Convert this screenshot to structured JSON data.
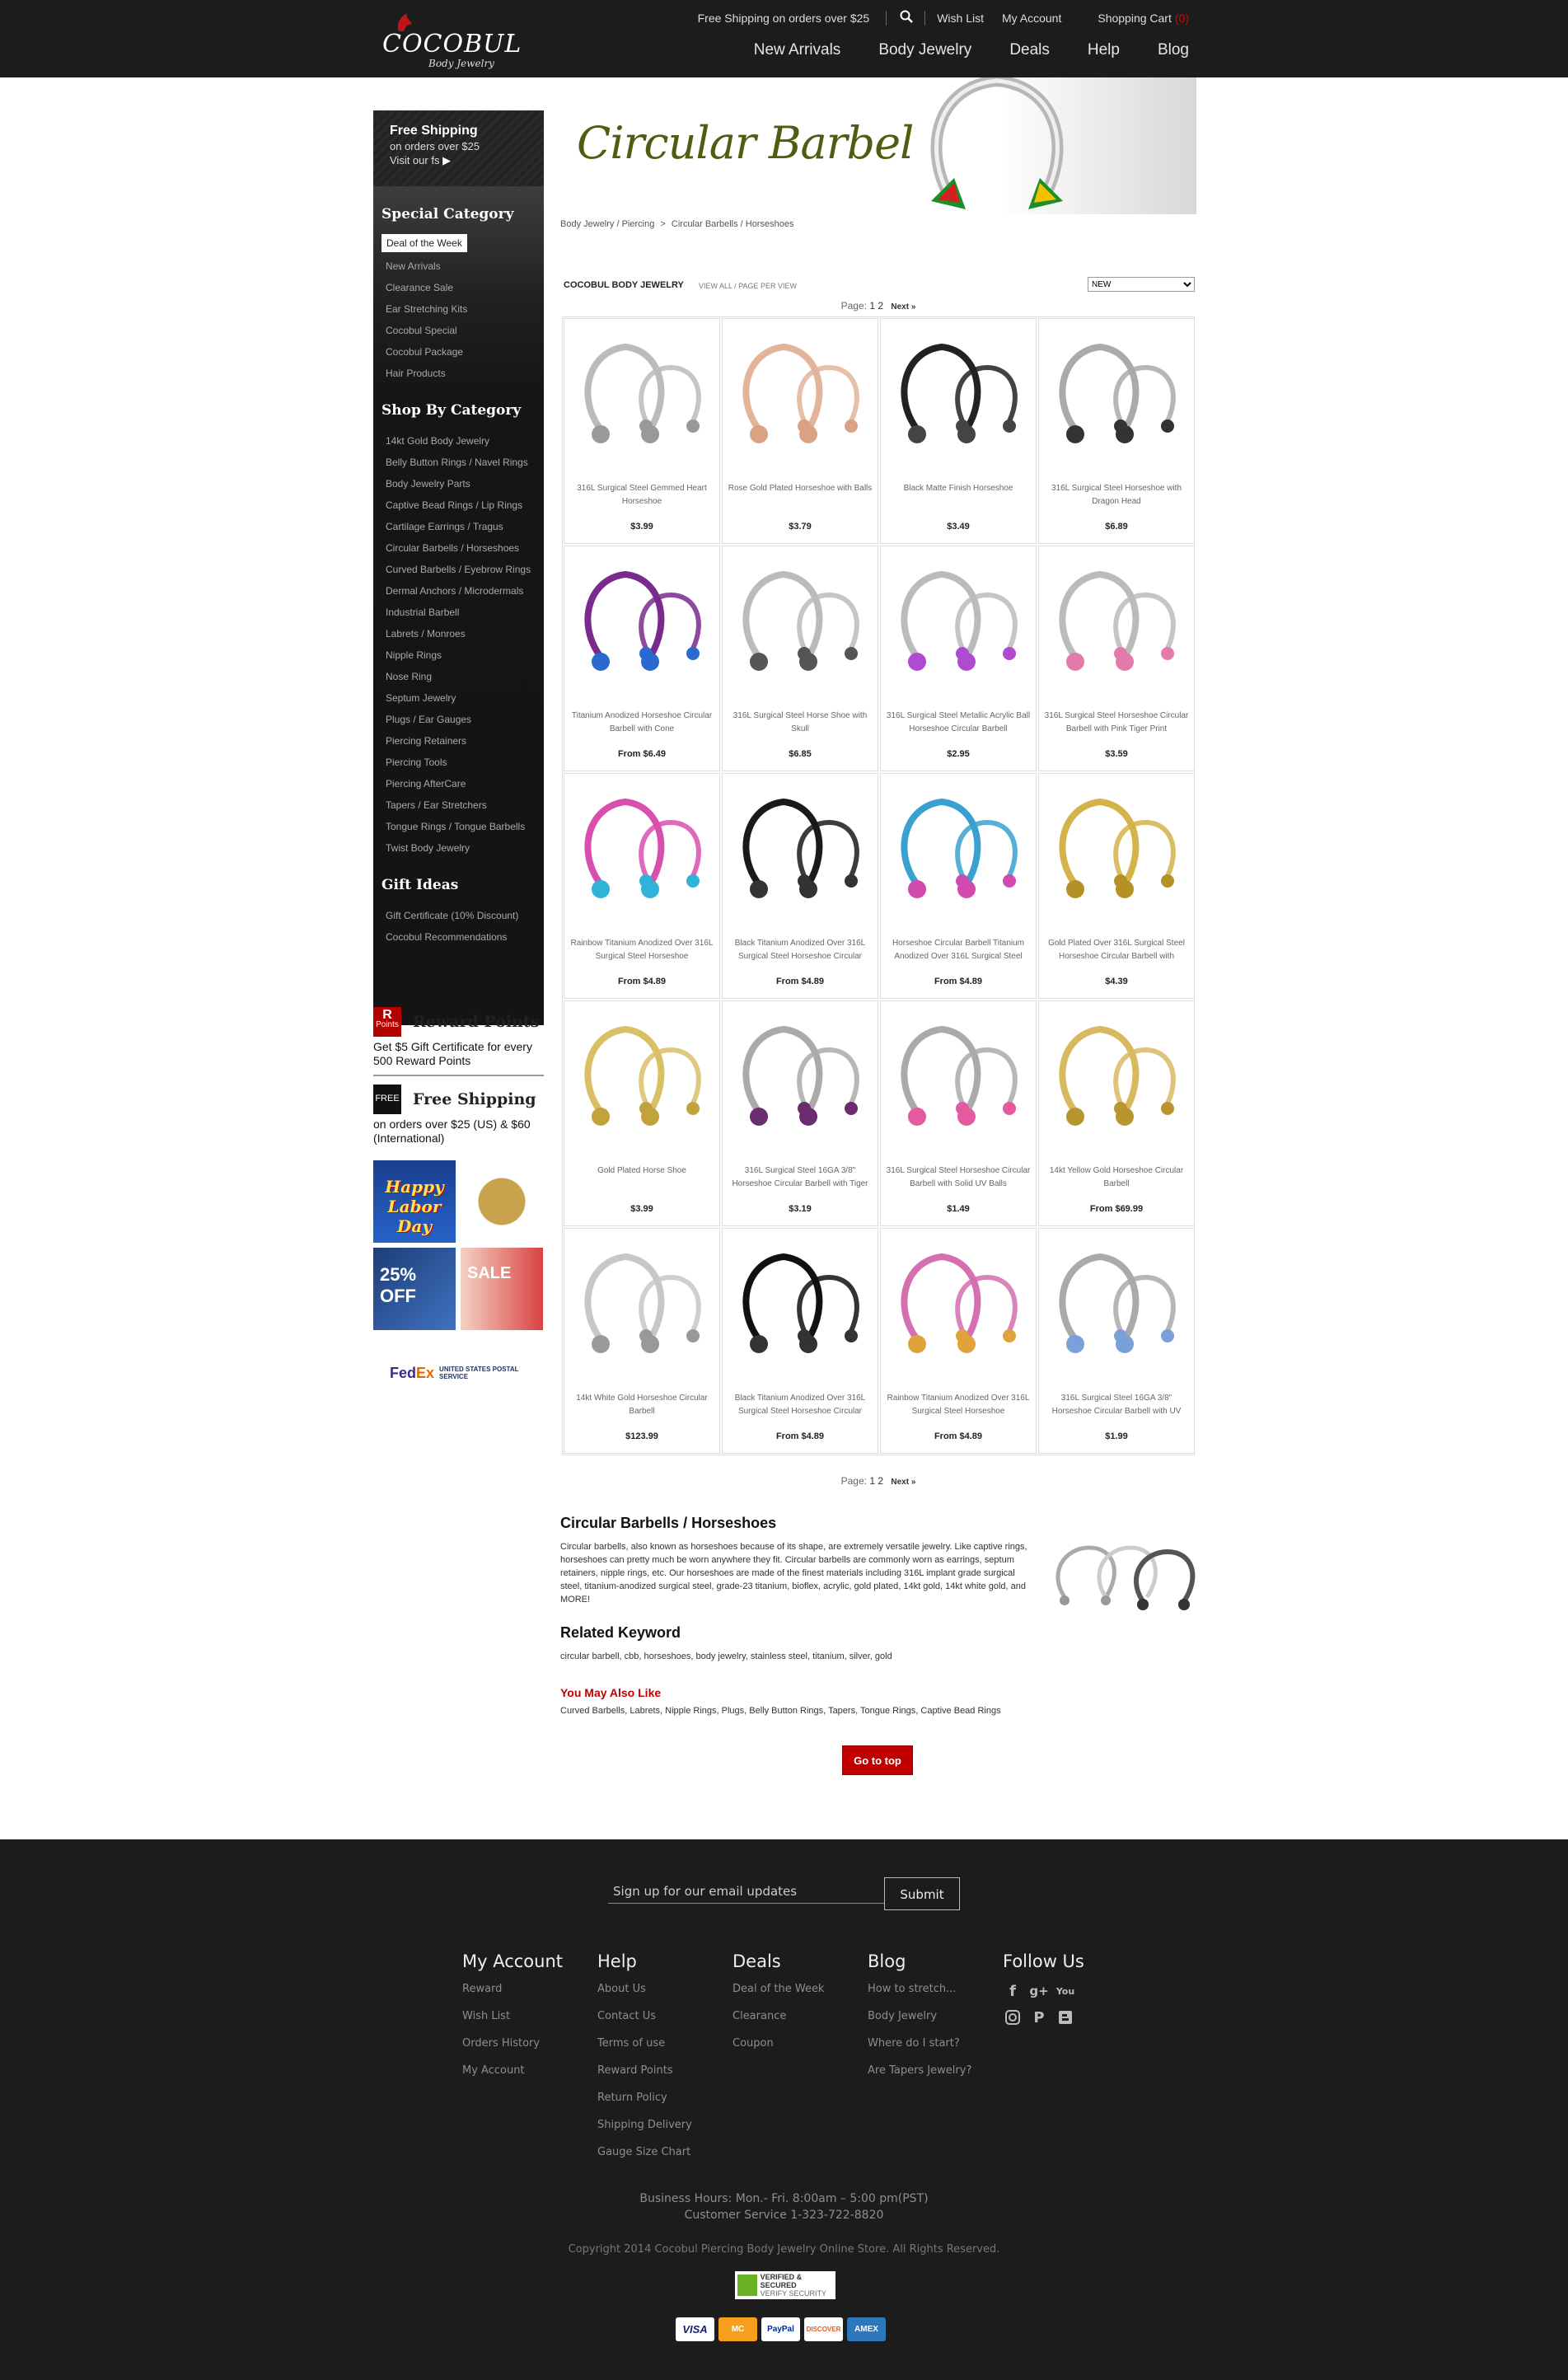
{
  "header": {
    "logo_text": "COCOBUL",
    "logo_sub": "Body Jewelry",
    "free_shipping": "Free Shipping on orders over $25",
    "wish_list": "Wish List",
    "my_account": "My Account",
    "shopping_cart": "Shopping Cart",
    "cart_count": "(0)",
    "nav": [
      "New Arrivals",
      "Body Jewelry",
      "Deals",
      "Help",
      "Blog"
    ]
  },
  "sidebar": {
    "free_ship_title": "Free Shipping",
    "free_ship_sub": "on orders over $25",
    "free_ship_link": "Visit our fs",
    "special_heading": "Special Category",
    "special_items": [
      "Deal of the Week",
      "New Arrivals",
      "Clearance Sale",
      "Ear Stretching Kits",
      "Cocobul Special",
      "Cocobul Package",
      "Hair Products"
    ],
    "shop_heading": "Shop By Category",
    "shop_items": [
      "14kt Gold Body Jewelry",
      "Belly Button Rings / Navel Rings",
      "Body Jewelry Parts",
      "Captive Bead Rings / Lip Rings",
      "Cartilage Earrings / Tragus",
      "Circular Barbells / Horseshoes",
      "Curved Barbells / Eyebrow Rings",
      "Dermal Anchors / Microdermals",
      "Industrial Barbell",
      "Labrets / Monroes",
      "Nipple Rings",
      "Nose Ring",
      "Septum Jewelry",
      "Plugs / Ear Gauges",
      "Piercing Retainers",
      "Piercing Tools",
      "Piercing AfterCare",
      "Tapers / Ear Stretchers",
      "Tongue Rings / Tongue Barbells",
      "Twist Body Jewelry"
    ],
    "gift_heading": "Gift Ideas",
    "gift_items": [
      "Gift Certificate (10% Discount)",
      "Cocobul Recommendations"
    ],
    "reward_badge": "R",
    "reward_badge_sub": "Points",
    "reward_title": "Reward Points",
    "reward_text": "Get $5 Gift Certificate for every 500 Reward Points",
    "ship_badge": "FREE",
    "ship_title": "Free Shipping",
    "ship_text": "on orders over $25 (US) & $60 (International)",
    "ad1": "Happy Labor Day",
    "ad3": "25% OFF",
    "ad4": "SALE",
    "fedex_a": "Fed",
    "fedex_b": "Ex",
    "usps": "UNITED STATES POSTAL SERVICE"
  },
  "main": {
    "banner_title": "Circular Barbell",
    "breadcrumb_a": "Body Jewelry / Piercing",
    "breadcrumb_sep": ">",
    "breadcrumb_b": "Circular Barbells / Horseshoes",
    "brand_label": "COCOBUL BODY JEWELRY",
    "view_all": "VIEW ALL / PAGE PER VIEW",
    "sort_value": "NEW",
    "page_label": "Page:",
    "page_1": "1",
    "page_2": "2",
    "next": "Next »",
    "go_top": "Go to top"
  },
  "products": [
    {
      "name": "316L Surgical Steel Gemmed Heart Horseshoe",
      "price": "$3.99",
      "icon": "heart-horseshoe"
    },
    {
      "name": "Rose Gold Plated Horseshoe with Balls",
      "price": "$3.79",
      "icon": "rose-gold-horseshoe"
    },
    {
      "name": "Black Matte Finish Horseshoe",
      "price": "$3.49",
      "icon": "black-horseshoe"
    },
    {
      "name": "316L Surgical Steel Horseshoe with Dragon Head",
      "price": "$6.89",
      "icon": "dragon-horseshoe"
    },
    {
      "name": "Titanium Anodized Horseshoe Circular Barbell with Cone",
      "price": "From $6.49",
      "icon": "cone-horseshoe"
    },
    {
      "name": "316L Surgical Steel Horse Shoe with Skull",
      "price": "$6.85",
      "icon": "skull-horseshoe"
    },
    {
      "name": "316L Surgical Steel Metallic Acrylic Ball Horseshoe Circular Barbell",
      "price": "$2.95",
      "icon": "acrylic-horseshoe"
    },
    {
      "name": "316L Surgical Steel Horseshoe Circular Barbell with Pink Tiger Print",
      "price": "$3.59",
      "icon": "pink-horseshoe"
    },
    {
      "name": "Rainbow Titanium Anodized Over 316L Surgical Steel Horseshoe",
      "price": "From $4.89",
      "icon": "rainbow-spike-horseshoe"
    },
    {
      "name": "Black Titanium Anodized Over 316L Surgical Steel Horseshoe Circular",
      "price": "From $4.89",
      "icon": "black-spike-horseshoe"
    },
    {
      "name": "Horseshoe Circular Barbell Titanium Anodized Over 316L Surgical Steel",
      "price": "From $4.89",
      "icon": "mixed-spike-horseshoe"
    },
    {
      "name": "Gold Plated Over 316L Surgical Steel Horseshoe Circular Barbell with",
      "price": "$4.39",
      "icon": "gold-spike-horseshoe"
    },
    {
      "name": "Gold Plated Horse Shoe",
      "price": "$3.99",
      "icon": "gold-horseshoe"
    },
    {
      "name": "316L Surgical Steel 16GA 3/8\" Horseshoe Circular Barbell with Tiger",
      "price": "$3.19",
      "icon": "tiger-horseshoe"
    },
    {
      "name": "316L Surgical Steel Horseshoe Circular Barbell with Solid UV Balls",
      "price": "$1.49",
      "icon": "uv-horseshoe"
    },
    {
      "name": "14kt Yellow Gold Horseshoe Circular Barbell",
      "price": "From $69.99",
      "icon": "14kt-gold-horseshoe"
    },
    {
      "name": "14kt White Gold Horseshoe Circular Barbell",
      "price": "$123.99",
      "icon": "white-gold-horseshoe"
    },
    {
      "name": "Black Titanium Anodized Over 316L Surgical Steel Horseshoe Circular",
      "price": "From $4.89",
      "icon": "black-ti-horseshoe"
    },
    {
      "name": "Rainbow Titanium Anodized Over 316L Surgical Steel Horseshoe",
      "price": "From $4.89",
      "icon": "rainbow-horseshoe"
    },
    {
      "name": "316L Surgical Steel 16GA 3/8\" Horseshoe Circular Barbell with UV",
      "price": "$1.99",
      "icon": "glitter-horseshoe"
    }
  ],
  "description": {
    "title": "Circular Barbells / Horseshoes",
    "body": "Circular barbells, also known as horseshoes because of its shape, are extremely versatile jewelry. Like captive rings, horseshoes can pretty much be worn anywhere they fit. Circular barbells are commonly worn as earrings, septum retainers, nipple rings, etc. Our horseshoes are made of the finest materials including 316L implant grade surgical steel, titanium-anodized surgical steel, grade-23 titanium, bioflex, acrylic, gold plated, 14kt gold, 14kt white gold, and MORE!",
    "related_title": "Related Keyword",
    "related_text": "circular barbell, cbb, horseshoes, body jewelry, stainless steel, titanium, silver, gold",
    "also_title": "You May Also Like",
    "also_text": "Curved Barbells, Labrets, Nipple Rings, Plugs, Belly Button Rings, Tapers, Tongue Rings, Captive Bead Rings"
  },
  "footer": {
    "signup_placeholder": "Sign up for our email updates",
    "submit": "Submit",
    "col_account": {
      "title": "My Account",
      "items": [
        "Reward",
        "Wish List",
        "Orders History",
        "My Account"
      ]
    },
    "col_help": {
      "title": "Help",
      "items": [
        "About Us",
        "Contact Us",
        "Terms of use",
        "Reward Points",
        "Return Policy",
        "Shipping Delivery",
        "Gauge Size Chart"
      ]
    },
    "col_deals": {
      "title": "Deals",
      "items": [
        "Deal of the Week",
        "Clearance",
        "Coupon"
      ]
    },
    "col_blog": {
      "title": "Blog",
      "items": [
        "How to stretch...",
        "Body Jewelry",
        "Where do I start?",
        "Are Tapers Jewelry?"
      ]
    },
    "follow_title": "Follow Us",
    "social": [
      "facebook-icon",
      "google-plus-icon",
      "youtube-icon",
      "instagram-icon",
      "pinterest-icon",
      "blogger-icon"
    ],
    "hours": "Business Hours: Mon.- Fri. 8:00am – 5:00 pm(PST)",
    "service": "Customer Service 1-323-722-8820",
    "copyright": "Copyright 2014 Cocobul Piercing Body Jewelry Online Store. All Rights Reserved.",
    "verified": "VERIFIED & SECURED",
    "verified_sub": "VERIFY SECURITY",
    "cards": [
      "VISA",
      "MC",
      "PayPal",
      "DISCOVER",
      "AMEX"
    ]
  },
  "colors": {
    "header_bg": "#1c1c1c",
    "accent_red": "#c00000",
    "banner_green": "#4d5e12"
  }
}
